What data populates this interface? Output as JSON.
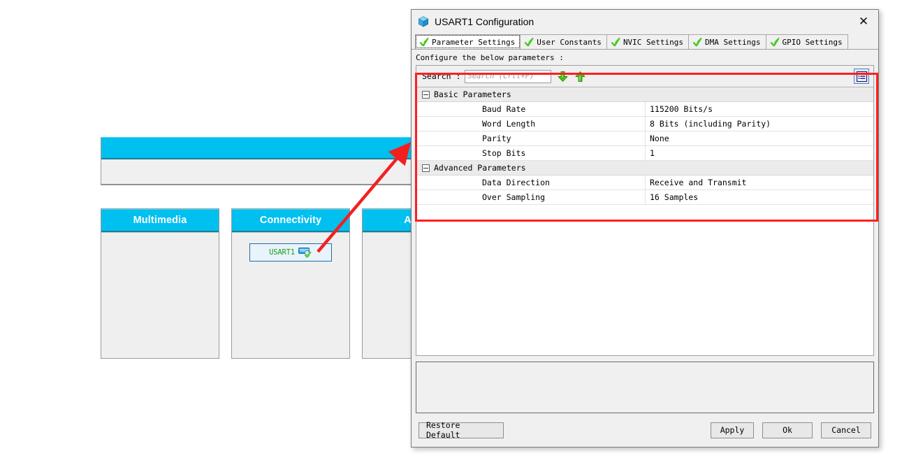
{
  "background": {
    "top_panel": {
      "title": ""
    },
    "categories": [
      {
        "title": "Multimedia",
        "items": []
      },
      {
        "title": "Connectivity",
        "items": [
          {
            "label": "USART1",
            "icon": "serial-port-icon",
            "configured": true
          }
        ]
      },
      {
        "title": "Analog",
        "items": []
      }
    ],
    "annotation": {
      "type": "arrow",
      "color": "#f42020"
    }
  },
  "dialog": {
    "title": "USART1 Configuration",
    "title_icon": "cube-icon",
    "close_label": "✕",
    "tabs": [
      {
        "label": "Parameter Settings",
        "icon": "green-check-icon",
        "active": true
      },
      {
        "label": "User Constants",
        "icon": "green-check-icon",
        "active": false
      },
      {
        "label": "NVIC Settings",
        "icon": "green-check-icon",
        "active": false
      },
      {
        "label": "DMA Settings",
        "icon": "green-check-icon",
        "active": false
      },
      {
        "label": "GPIO Settings",
        "icon": "green-check-icon",
        "active": false
      }
    ],
    "note": "Configure the below parameters :",
    "search": {
      "label": "Search :",
      "value": "",
      "placeholder": "Search (Crtl+F)",
      "next_icon": "arrow-down-icon",
      "prev_icon": "arrow-up-icon",
      "view_toggle_icon": "list-view-icon"
    },
    "highlight_box_color": "#ff1f1f",
    "groups": [
      {
        "title": "Basic Parameters",
        "expanded": true,
        "rows": [
          {
            "name": "Baud Rate",
            "value": "115200 Bits/s"
          },
          {
            "name": "Word Length",
            "value": "8 Bits (including Parity)"
          },
          {
            "name": "Parity",
            "value": "None"
          },
          {
            "name": "Stop Bits",
            "value": "1"
          }
        ]
      },
      {
        "title": "Advanced Parameters",
        "expanded": true,
        "rows": [
          {
            "name": "Data Direction",
            "value": "Receive and Transmit"
          },
          {
            "name": "Over Sampling",
            "value": "16 Samples"
          }
        ]
      }
    ],
    "description_pane": {
      "text": ""
    },
    "buttons": {
      "restore": "Restore Default",
      "apply": "Apply",
      "ok": "Ok",
      "cancel": "Cancel"
    }
  }
}
